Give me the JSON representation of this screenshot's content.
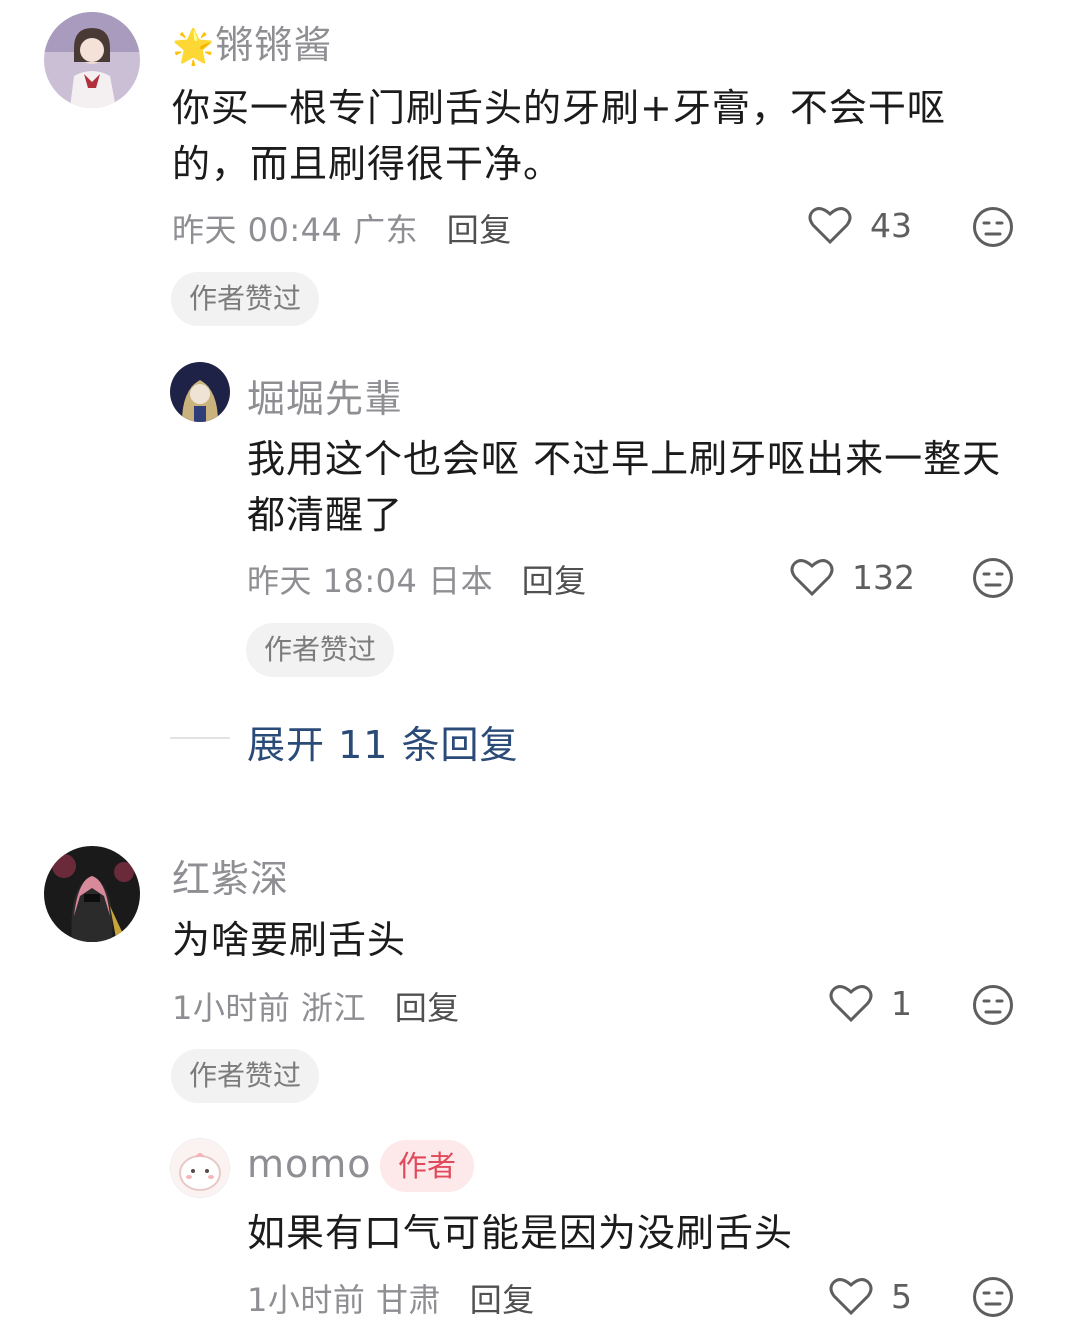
{
  "comments": [
    {
      "username": "锵锵酱",
      "text": "你买一根专门刷舌头的牙刷+牙膏，不会干呕的，而且刷得很干净。",
      "time": "昨天 00:44",
      "location": "广东",
      "reply_label": "回复",
      "likes": "43",
      "badge": "作者赞过",
      "username_emoji": "🌟"
    },
    {
      "username": "堀堀先輩",
      "text": "我用这个也会呕 不过早上刷牙呕出来一整天都清醒了",
      "time": "昨天 18:04",
      "location": "日本",
      "reply_label": "回复",
      "likes": "132",
      "badge": "作者赞过"
    },
    {
      "username": "红紫深",
      "text": "为啥要刷舌头",
      "time": "1小时前",
      "location": "浙江",
      "reply_label": "回复",
      "likes": "1",
      "badge": "作者赞过"
    },
    {
      "username": "momo",
      "author_tag": "作者",
      "text": "如果有口气可能是因为没刷舌头",
      "time": "1小时前",
      "location": "甘肃",
      "reply_label": "回复",
      "likes": "5"
    }
  ],
  "expand_replies": "展开 11 条回复",
  "colors": {
    "username": "#8e8e93",
    "text": "#1b1b1b",
    "expand": "#2a4a78",
    "author_tag_bg": "#fde8ea",
    "author_tag_text": "#e14a5a"
  },
  "icons": [
    "heart-outline-icon",
    "dislike-face-icon"
  ]
}
